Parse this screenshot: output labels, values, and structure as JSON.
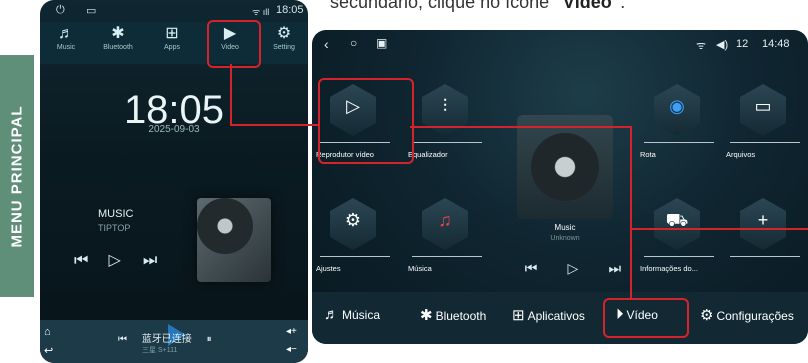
{
  "caption": {
    "prefix": "secundário, clique no ícone ",
    "bold": "\"Vídeo\"",
    "suffix": "."
  },
  "side_label": "MENU PRINCIPAL",
  "phone": {
    "status_time": "18:05",
    "nav": [
      {
        "icon": "music-icon",
        "glyph": "♬",
        "label": "Music"
      },
      {
        "icon": "bluetooth-icon",
        "glyph": "✱",
        "label": "Bluetooth"
      },
      {
        "icon": "apps-icon",
        "glyph": "⊞",
        "label": "Apps"
      },
      {
        "icon": "video-icon",
        "glyph": "▶",
        "label": "Video"
      },
      {
        "icon": "gear-icon",
        "glyph": "⚙",
        "label": "Setting"
      }
    ],
    "clock": "18:05",
    "date": "2025-09-03",
    "music_title": "MUSIC",
    "music_artist": "TIPTOP",
    "bottom_text": "蓝牙已连接",
    "bottom_sub": "三星 S+111"
  },
  "tablet": {
    "status_volume": "12",
    "status_time": "14:48",
    "apps": [
      {
        "label": "Reprodutor vídeo",
        "glyph": "▷"
      },
      {
        "label": "Equalizador",
        "glyph": "⫶"
      },
      {
        "label": "Rota",
        "glyph": "◉"
      },
      {
        "label": "Arquivos",
        "glyph": "▭"
      },
      {
        "label": "Ajustes",
        "glyph": "⚙"
      },
      {
        "label": "Música",
        "glyph": "♫"
      },
      {
        "label": "Informações do...",
        "glyph": "⛟"
      },
      {
        "label": "",
        "glyph": "+"
      }
    ],
    "music_title": "Music",
    "music_sub": "Unknown",
    "dock": [
      {
        "icon": "music-icon",
        "glyph": "♬",
        "label": "Música"
      },
      {
        "icon": "bluetooth-icon",
        "glyph": "✱",
        "label": "Bluetooth"
      },
      {
        "icon": "apps-icon",
        "glyph": "⊞",
        "label": "Aplicativos"
      },
      {
        "icon": "video-icon",
        "glyph": "⏵",
        "label": "Vídeo"
      },
      {
        "icon": "gear-icon",
        "glyph": "⚙",
        "label": "Configurações"
      }
    ]
  },
  "colors": {
    "highlight": "#d6232b",
    "side_label_bg": "#5f8f78"
  }
}
